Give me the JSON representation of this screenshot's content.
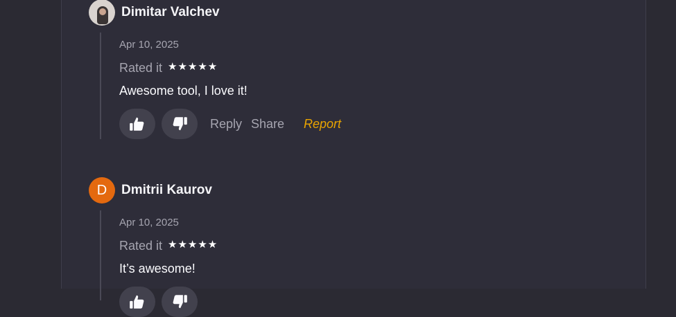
{
  "reviews": [
    {
      "author": "Dimitar Valchev",
      "avatar_type": "photo",
      "date": "Apr 10, 2025",
      "rated_label": "Rated it",
      "stars_display": "★★★★★",
      "rating": 5,
      "comment": "Awesome tool, I love it!",
      "actions": {
        "reply": "Reply",
        "share": "Share",
        "report": "Report"
      }
    },
    {
      "author": "Dmitrii Kaurov",
      "avatar_type": "initial",
      "avatar_initial": "D",
      "avatar_color": "#e4690f",
      "date": "Apr 10, 2025",
      "rated_label": "Rated it",
      "stars_display": "★★★★★",
      "rating": 5,
      "comment": "It’s awesome!"
    }
  ],
  "icons": {
    "like": "thumbs-up-icon",
    "dislike": "thumbs-down-icon"
  },
  "colors": {
    "background": "#2b2a33",
    "panel": "#2e2d39",
    "button_bg": "#42414d",
    "report": "#e9a400",
    "muted_text": "#a6a5b0"
  }
}
